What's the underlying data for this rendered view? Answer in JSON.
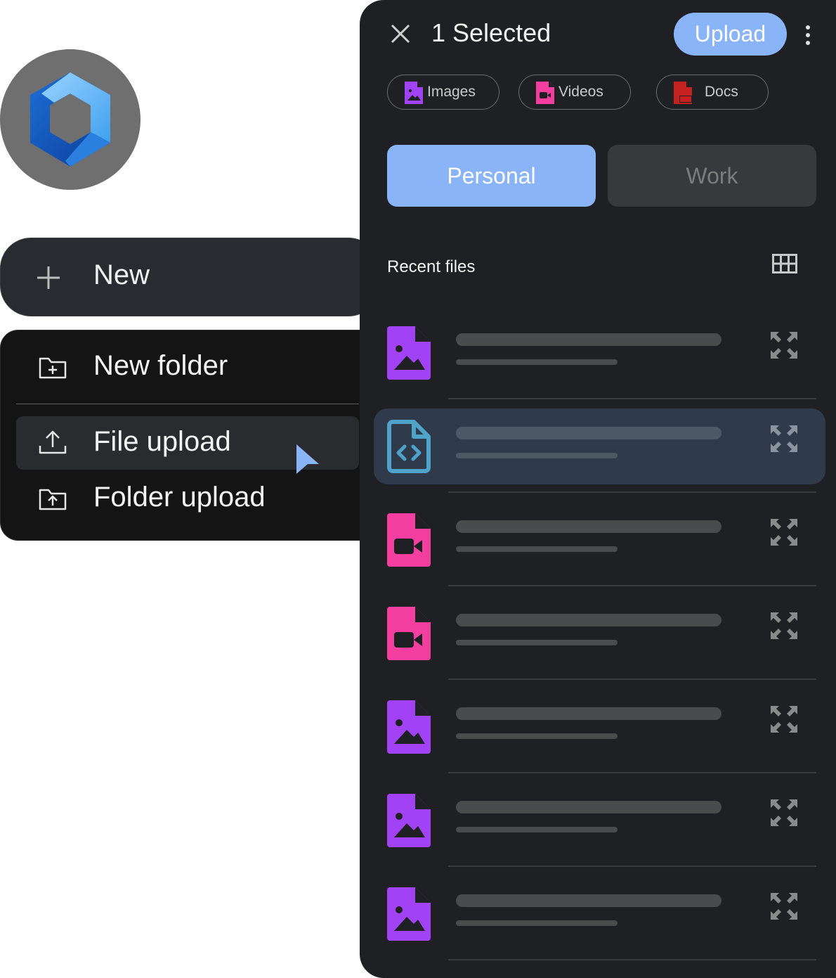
{
  "colors": {
    "accent": "#8ab4f8",
    "panel_bg": "#1f2023",
    "menu_bg": "#141414",
    "image_file": "#a142f4",
    "video_file": "#f43fa0",
    "code_file": "#4fa3c8",
    "pdf_file": "#c5221f"
  },
  "new_button": {
    "label": "New",
    "icon": "plus-icon"
  },
  "menu": {
    "items": [
      {
        "label": "New folder",
        "icon": "folder-plus-icon"
      },
      {
        "label": "File upload",
        "icon": "upload-icon",
        "active": true
      },
      {
        "label": "Folder upload",
        "icon": "folder-upload-icon"
      }
    ]
  },
  "panel": {
    "title": "1 Selected",
    "upload_label": "Upload",
    "chips": [
      {
        "label": "Images",
        "icon": "image-file-icon"
      },
      {
        "label": "Videos",
        "icon": "video-file-icon"
      },
      {
        "label": "Docs",
        "icon": "pdf-file-icon"
      }
    ],
    "tabs": [
      {
        "label": "Personal",
        "active": true
      },
      {
        "label": "Work",
        "active": false
      }
    ],
    "recent_title": "Recent files",
    "files": [
      {
        "type": "image",
        "selected": false
      },
      {
        "type": "code",
        "selected": true
      },
      {
        "type": "video",
        "selected": false
      },
      {
        "type": "video",
        "selected": false
      },
      {
        "type": "image",
        "selected": false
      },
      {
        "type": "image",
        "selected": false
      },
      {
        "type": "image",
        "selected": false
      }
    ]
  }
}
